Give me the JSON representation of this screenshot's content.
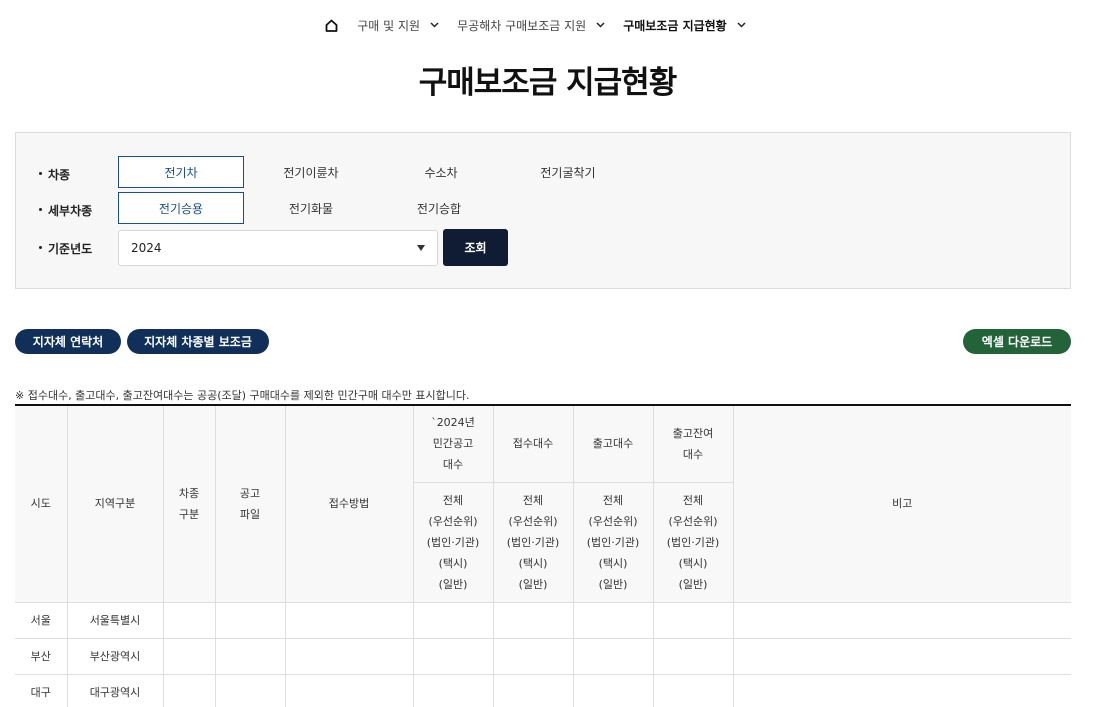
{
  "breadcrumb": {
    "items": [
      {
        "label": "구매 및 지원"
      },
      {
        "label": "무공해차 구매보조금 지원"
      },
      {
        "label": "구매보조금 지급현황"
      }
    ]
  },
  "page_title": "구매보조금 지급현황",
  "filters": {
    "vehicle_type": {
      "label": "차종",
      "options": [
        "전기차",
        "전기이륜차",
        "수소차",
        "전기굴착기"
      ],
      "selected": "전기차"
    },
    "sub_type": {
      "label": "세부차종",
      "options": [
        "전기승용",
        "전기화물",
        "전기승합"
      ],
      "selected": "전기승용"
    },
    "year": {
      "label": "기준년도",
      "value": "2024"
    },
    "search_label": "조회"
  },
  "actions": {
    "contacts_label": "지자체 연락처",
    "subsidy_label": "지자체 차종별 보조금",
    "excel_label": "엑셀 다운로드"
  },
  "notice": "※ 접수대수, 출고대수, 출고잔여대수는 공공(조달) 구매대수를 제외한 민간구매 대수만 표시합니다.",
  "table": {
    "headers": {
      "sido": "시도",
      "region": "지역구분",
      "vehicle_type": [
        "차종",
        "구분"
      ],
      "notice_file": [
        "공고",
        "파일"
      ],
      "method": "접수방법",
      "announced": [
        "`2024년",
        "민간공고",
        "대수"
      ],
      "received": "접수대수",
      "delivered": "출고대수",
      "remaining": [
        "출고잔여",
        "대수"
      ],
      "remarks": "비고",
      "breakdown": [
        "전체",
        "(우선순위)",
        "(법인·기관)",
        "(택시)",
        "(일반)"
      ]
    },
    "rows": [
      {
        "sido": "서울",
        "region": "서울특별시"
      },
      {
        "sido": "부산",
        "region": "부산광역시"
      },
      {
        "sido": "대구",
        "region": "대구광역시"
      }
    ]
  },
  "colors": {
    "navy_button": "#10305a",
    "search_button": "#0f1c33",
    "excel_button": "#22633a",
    "selected_border": "#1a4f8b"
  }
}
